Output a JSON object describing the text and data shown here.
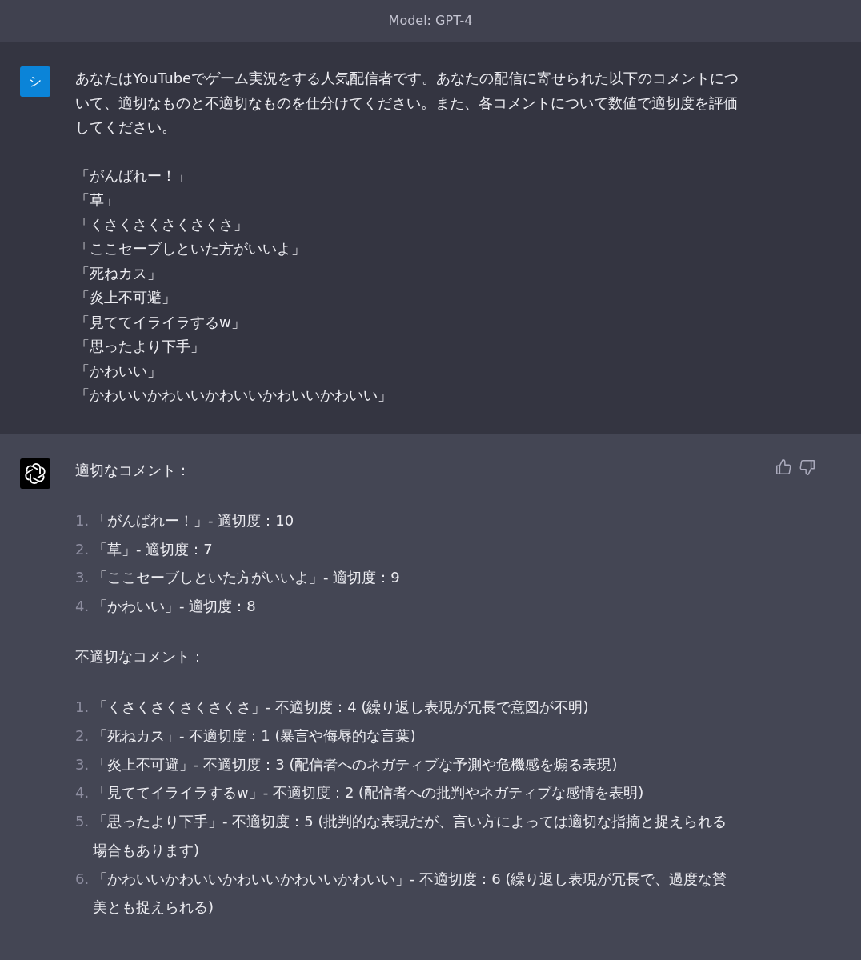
{
  "header": {
    "title": "Model: GPT-4"
  },
  "messages": [
    {
      "kind": "user",
      "avatar": "シ",
      "paragraphs": [
        "あなたはYouTubeでゲーム実況をする人気配信者です。あなたの配信に寄せられた以下のコメントについて、適切なものと不適切なものを仕分けてください。また、各コメントについて数値で適切度を評価してください。"
      ],
      "lines": [
        "「がんばれー！」",
        "「草」",
        "「くさくさくさくさくさ」",
        "「ここセーブしといた方がいいよ」",
        "「死ねカス」",
        "「炎上不可避」",
        "「見ててイライラするw」",
        "「思ったより下手」",
        "「かわいい」",
        "「かわいいかわいいかわいいかわいいかわいい」"
      ]
    },
    {
      "kind": "assistant",
      "sections": [
        {
          "heading": "適切なコメント：",
          "items": [
            {
              "number": "1.",
              "text": "「がんばれー！」- 適切度：10"
            },
            {
              "number": "2.",
              "text": "「草」- 適切度：7"
            },
            {
              "number": "3.",
              "text": "「ここセーブしといた方がいいよ」- 適切度：9"
            },
            {
              "number": "4.",
              "text": "「かわいい」- 適切度：8"
            }
          ]
        },
        {
          "heading": "不適切なコメント：",
          "items": [
            {
              "number": "1.",
              "text": "「くさくさくさくさくさ」- 不適切度：4 (繰り返し表現が冗長で意図が不明)"
            },
            {
              "number": "2.",
              "text": "「死ねカス」- 不適切度：1 (暴言や侮辱的な言葉)"
            },
            {
              "number": "3.",
              "text": "「炎上不可避」- 不適切度：3 (配信者へのネガティブな予測や危機感を煽る表現)"
            },
            {
              "number": "4.",
              "text": "「見ててイライラするw」- 不適切度：2 (配信者への批判やネガティブな感情を表明)"
            },
            {
              "number": "5.",
              "text": "「思ったより下手」- 不適切度：5 (批判的な表現だが、言い方によっては適切な指摘と捉えられる場合もあります)"
            },
            {
              "number": "6.",
              "text": "「かわいいかわいいかわいいかわいいかわいい」- 不適切度：6 (繰り返し表現が冗長で、過度な賛美とも捉えられる)"
            }
          ]
        }
      ]
    }
  ]
}
